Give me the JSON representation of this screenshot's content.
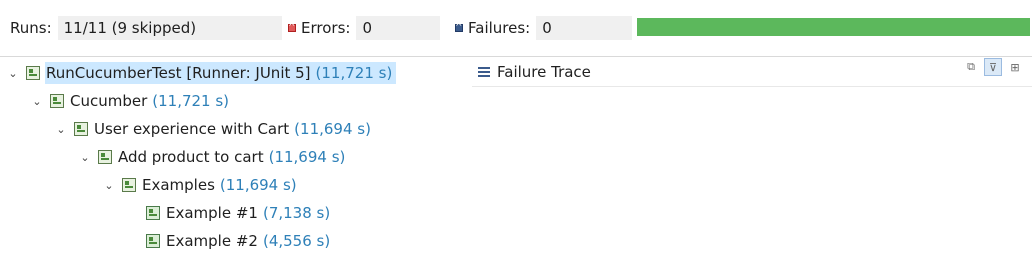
{
  "stats": {
    "runs_label": "Runs:",
    "runs_value": "11/11 (9 skipped)",
    "errors_label": "Errors:",
    "errors_value": "0",
    "failures_label": "Failures:",
    "failures_value": "0",
    "progress_fraction": 1.0,
    "progress_color": "#5cb85c"
  },
  "tree": {
    "nodes": [
      {
        "label": "RunCucumberTest [Runner: JUnit 5]",
        "time": "(11,721 s)",
        "depth": 0,
        "expanded": true,
        "selected": true
      },
      {
        "label": "Cucumber",
        "time": "(11,721 s)",
        "depth": 1,
        "expanded": true
      },
      {
        "label": "User experience with Cart",
        "time": "(11,694 s)",
        "depth": 2,
        "expanded": true
      },
      {
        "label": "Add product to cart",
        "time": "(11,694 s)",
        "depth": 3,
        "expanded": true
      },
      {
        "label": "Examples",
        "time": "(11,694 s)",
        "depth": 4,
        "expanded": true
      },
      {
        "label": "Example #1",
        "time": "(7,138 s)",
        "depth": 5,
        "leaf": true
      },
      {
        "label": "Example #2",
        "time": "(4,556 s)",
        "depth": 5,
        "leaf": true
      }
    ]
  },
  "trace": {
    "title": "Failure Trace",
    "icons": [
      "compare-results-icon",
      "filter-stack-icon",
      "pin-trace-icon"
    ]
  }
}
